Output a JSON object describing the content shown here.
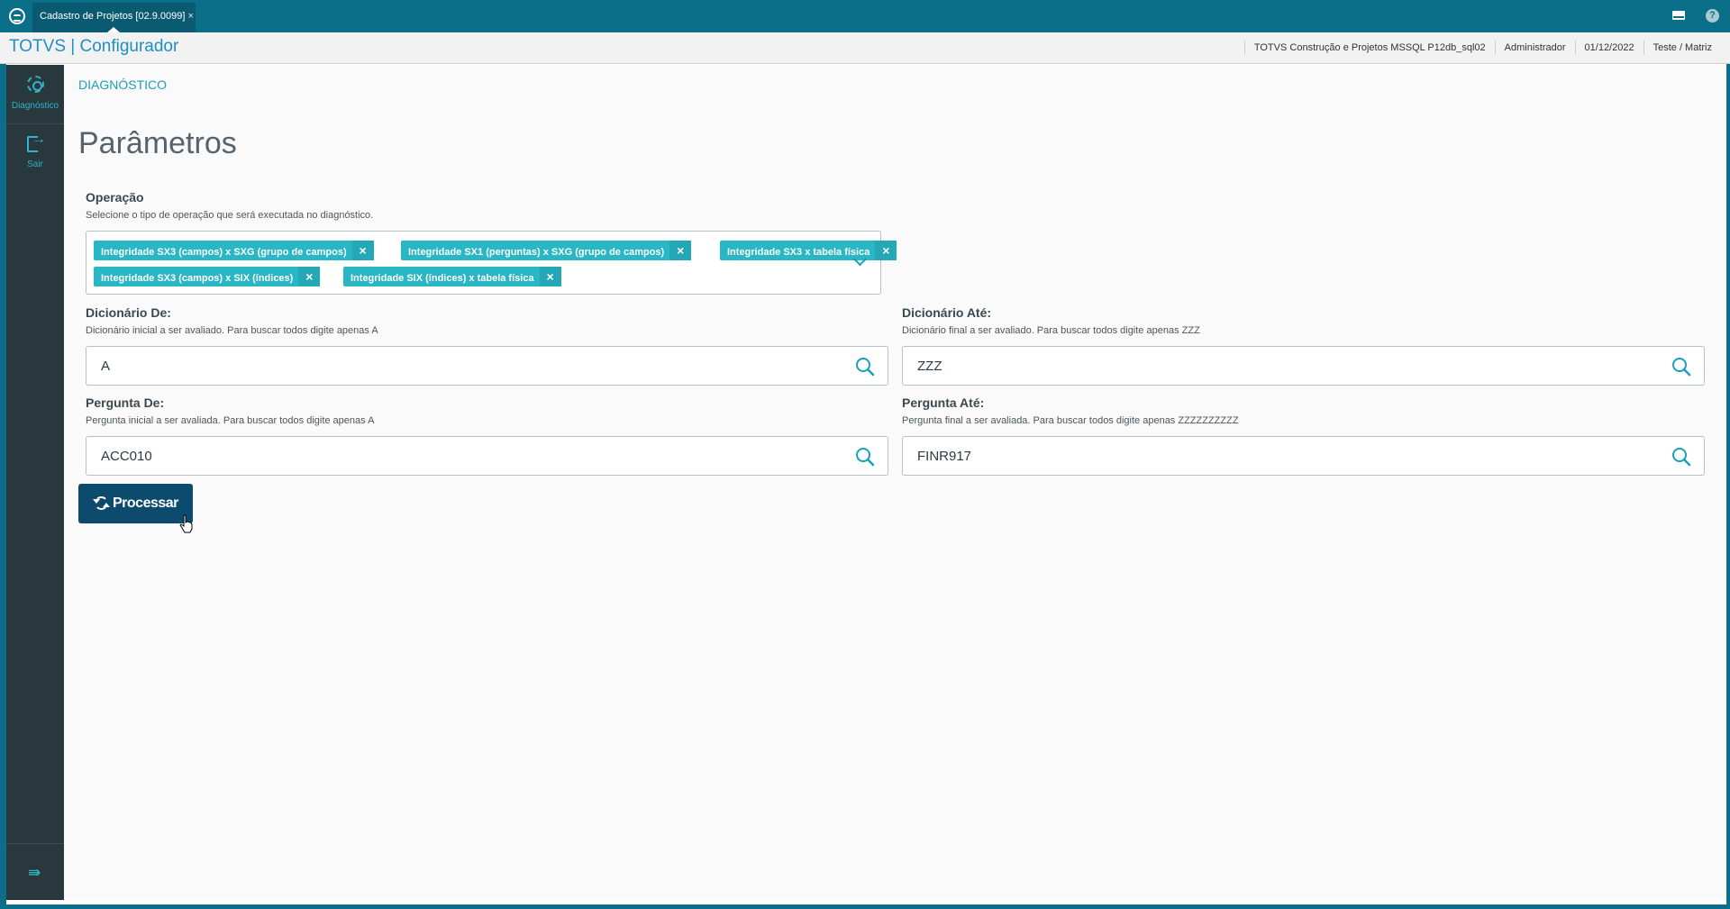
{
  "topbar": {
    "tab_label": "Cadastro de Projetos [02.9.0099]",
    "tab_close": "×",
    "icons": [
      "app-logo-icon",
      "mail-icon",
      "help-icon"
    ],
    "help_glyph": "?"
  },
  "header": {
    "title": "TOTVS | Configurador",
    "environment": "TOTVS Construção e Projetos MSSQL P12db_sql02",
    "user": "Administrador",
    "date": "01/12/2022",
    "branch": "Teste / Matriz"
  },
  "sidebar": {
    "items": [
      {
        "label": "Diagnóstico",
        "icon": "gear-icon"
      },
      {
        "label": "Sair",
        "icon": "exit-icon"
      }
    ],
    "collapse_glyph": "⇛"
  },
  "main": {
    "breadcrumb": "DIAGNÓSTICO",
    "title": "Parâmetros",
    "operation": {
      "label": "Operação",
      "help": "Selecione o tipo de operação que será executada no diagnóstico.",
      "chips": [
        "Integridade SX3 (campos) x SXG (grupo de campos)",
        "Integridade SX1 (perguntas) x SXG (grupo de campos)",
        "Integridade SX3 x tabela física",
        "Integridade SX3 (campos) x SIX (índices)",
        "Integridade SIX (índices) x tabela física"
      ],
      "chip_close": "×"
    },
    "dict_from": {
      "label": "Dicionário De:",
      "help": "Dicionário inicial a ser avaliado. Para buscar todos digite apenas A",
      "value": "A"
    },
    "dict_to": {
      "label": "Dicionário Até:",
      "help": "Dicionário final a ser avaliado. Para buscar todos digite apenas ZZZ",
      "value": "ZZZ"
    },
    "question_from": {
      "label": "Pergunta De:",
      "help": "Pergunta inicial a ser avaliada. Para buscar todos digite apenas A",
      "value": "ACC010"
    },
    "question_to": {
      "label": "Pergunta Até:",
      "help": "Pergunta final a ser avaliada. Para buscar todos digite apenas ZZZZZZZZZZ",
      "value": "FINR917"
    },
    "process_label": "Processar"
  },
  "colors": {
    "topbar": "#0c6f8a",
    "accent": "#1b9fb8",
    "chip": "#29b6c5",
    "sidebar": "#29383c",
    "primary_button": "#0c4a6e"
  }
}
